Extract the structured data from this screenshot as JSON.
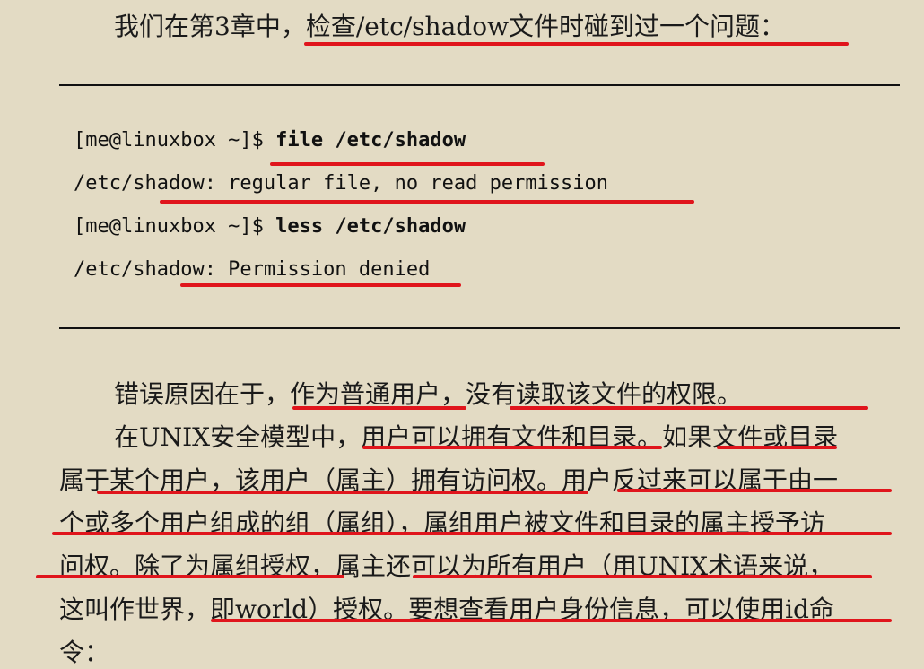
{
  "intro": "我们在第3章中，检查/etc/shadow文件时碰到过一个问题：",
  "code": {
    "line1_prompt": "[me@linuxbox ~]$ ",
    "line1_cmd": "file /etc/shadow",
    "line2": "/etc/shadow: regular file, no read permission",
    "line3_prompt": "[me@linuxbox ~]$ ",
    "line3_cmd": "less /etc/shadow",
    "line4": "/etc/shadow: Permission denied"
  },
  "para1": "错误原因在于，作为普通用户，没有读取该文件的权限。",
  "para2": {
    "l1": "在UNIX安全模型中，用户可以拥有文件和目录。如果文件或目录",
    "l2": "属于某个用户，该用户（属主）拥有访问权。用户反过来可以属于由一",
    "l3": "个或多个用户组成的组（属组），属组用户被文件和目录的属主授予访",
    "l4": "问权。除了为属组授权，属主还可以为所有用户（用UNIX术语来说，",
    "l5": "这叫作世界，即world）授权。要想查看用户身份信息，可以使用id命",
    "l6": "令："
  },
  "colors": {
    "background": "#e3dbc4",
    "underline": "#e0151c",
    "text": "#1a1a1a"
  }
}
